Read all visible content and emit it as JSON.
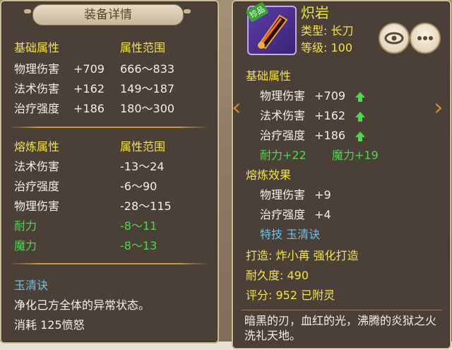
{
  "left": {
    "title": "装备详情",
    "basic_header": {
      "left": "基础属性",
      "right": "属性范围"
    },
    "basic_rows": [
      {
        "name": "物理伤害",
        "value": "+709",
        "range": "666～833"
      },
      {
        "name": "法术伤害",
        "value": "+162",
        "range": "149～187"
      },
      {
        "name": "治疗强度",
        "value": "+186",
        "range": "180～300"
      }
    ],
    "refine_header": {
      "left": "熔炼属性",
      "right": "属性范围"
    },
    "refine_rows": [
      {
        "name": "法术伤害",
        "range": "-13～24"
      },
      {
        "name": "治疗强度",
        "range": "-6～90"
      },
      {
        "name": "物理伤害",
        "range": "-28～115"
      },
      {
        "name": "耐力",
        "range": "-8～11"
      },
      {
        "name": "魔力",
        "range": "-8～13"
      }
    ],
    "skill": {
      "name": "玉清诀",
      "desc": "净化己方全体的异常状态。",
      "cost": "消耗 125愤怒"
    }
  },
  "right": {
    "item_name": "炽岩",
    "badge": "珍品",
    "type": "类型: 长刀",
    "level": "等级: 100",
    "basic_header": "基础属性",
    "basic_rows": [
      {
        "name": "物理伤害",
        "value": "+709"
      },
      {
        "name": "法术伤害",
        "value": "+162"
      },
      {
        "name": "治疗强度",
        "value": "+186"
      }
    ],
    "bonus": {
      "stamina": "耐力+22",
      "magic": "魔力+19"
    },
    "refine_header": "熔炼效果",
    "refine_rows": [
      {
        "name": "物理伤害",
        "value": "+9"
      },
      {
        "name": "治疗强度",
        "value": "+4"
      }
    ],
    "special": "特技  玉清诀",
    "forge": "打造: 炸小苒   强化打造",
    "durability": "耐久度: 490",
    "score": "评分: 952   已附灵",
    "description": "暗黑的刃，血红的光，沸腾的炎狱之火洗礼天地。"
  },
  "colors": {
    "header": "#f3e24b",
    "green": "#4bd94a",
    "skill": "#62c4ee"
  }
}
